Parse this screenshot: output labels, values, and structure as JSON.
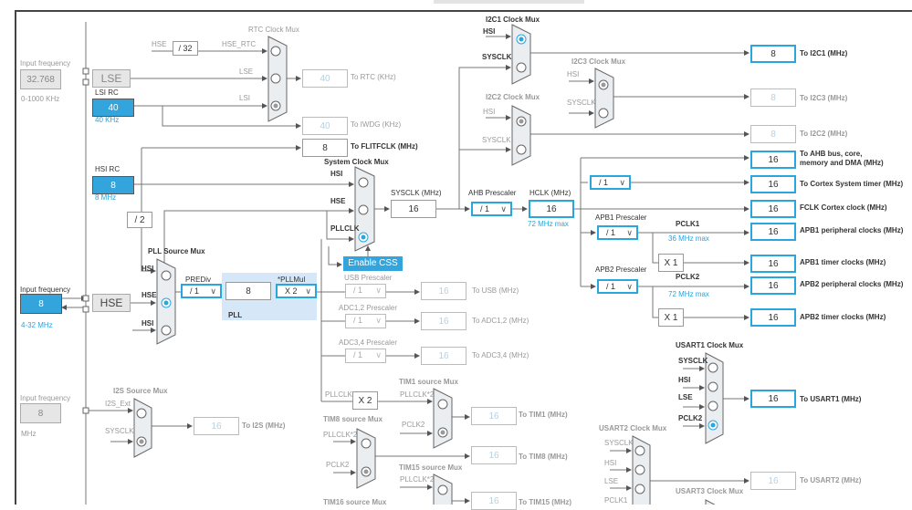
{
  "lse_input": {
    "label": "Input frequency",
    "value": "32.768",
    "range": "0-1000 KHz"
  },
  "lse": {
    "label": "LSE"
  },
  "lsi": {
    "title": "LSI RC",
    "value": "40",
    "freq": "40 KHz"
  },
  "rtc_mux": {
    "title": "RTC Clock Mux",
    "hse": "HSE",
    "div": "/ 32",
    "hse_rtc": "HSE_RTC",
    "lse": "LSE",
    "lsi": "LSI",
    "selected": "LSI"
  },
  "rtc_out": {
    "value": "40",
    "label": "To RTC (KHz)"
  },
  "iwdg_out": {
    "value": "40",
    "label": "To IWDG (KHz)"
  },
  "flitf_out": {
    "value": "8",
    "label": "To FLITFCLK (MHz)"
  },
  "hsi": {
    "title": "HSI RC",
    "value": "8",
    "freq": "8 MHz",
    "div2": "/ 2"
  },
  "sys_mux": {
    "title": "System Clock Mux",
    "hsi": "HSI",
    "hse": "HSE",
    "pllclk": "PLLCLK",
    "selected": "PLLCLK"
  },
  "sysclk": {
    "label": "SYSCLK (MHz)",
    "value": "16"
  },
  "enable_css": "Enable CSS",
  "pll_mux": {
    "title": "PLL Source Mux",
    "hsi1": "HSI",
    "hse": "HSE",
    "hsi2": "HSI",
    "selected": "HSE"
  },
  "hse_input": {
    "label": "Input frequency",
    "value": "8",
    "range": "4-32 MHz",
    "box": "HSE"
  },
  "pll": {
    "prediv_label": "PREDiv",
    "prediv": "/ 1",
    "value": "8",
    "mul_label": "*PLLMul",
    "mul": "X 2",
    "title": "PLL"
  },
  "usb": {
    "label": "USB Prescaler",
    "presc": "/ 1",
    "value": "16",
    "out": "To USB (MHz)"
  },
  "adc12": {
    "label": "ADC1,2 Prescaler",
    "presc": "/ 1",
    "value": "16",
    "out": "To ADC1,2 (MHz)"
  },
  "adc34": {
    "label": "ADC3,4 Prescaler",
    "presc": "/ 1",
    "value": "16",
    "out": "To ADC3,4 (MHz)"
  },
  "tim": {
    "pllclk": "PLLCLK",
    "x2": "X 2",
    "tim1": {
      "title": "TIM1 source Mux",
      "in1": "PLLCLK*2",
      "in2": "PCLK2",
      "value": "16",
      "out": "To TIM1 (MHz)"
    },
    "tim8": {
      "title": "TIM8 source Mux",
      "in1": "PLLCLK*2",
      "in2": "PCLK2",
      "value": "16",
      "out": "To TIM8 (MHz)"
    },
    "tim15": {
      "title": "TIM15 source Mux",
      "in1": "PLLCLK*2",
      "value": "16",
      "out": "To TIM15 (MHz)"
    },
    "tim16": {
      "title": "TIM16 source Mux"
    }
  },
  "i2s_input": {
    "label": "Input frequency",
    "value": "8",
    "unit": "MHz"
  },
  "i2s": {
    "title": "I2S Source Mux",
    "in1": "I2S_Ext",
    "in2": "SYSCLK",
    "value": "16",
    "out": "To I2S (MHz)"
  },
  "i2c1": {
    "title": "I2C1 Clock Mux",
    "hsi": "HSI",
    "sysclk": "SYSCLK",
    "value": "8",
    "out": "To I2C1 (MHz)",
    "selected": "HSI"
  },
  "i2c3": {
    "title": "I2C3 Clock Mux",
    "hsi": "HSI",
    "sysclk": "SYSCLK",
    "value": "8",
    "out": "To I2C3 (MHz)"
  },
  "i2c2": {
    "title": "I2C2 Clock Mux",
    "hsi": "HSI",
    "sysclk": "SYSCLK",
    "value": "8",
    "out": "To I2C2 (MHz)"
  },
  "ahb": {
    "label": "AHB Prescaler",
    "presc": "/ 1"
  },
  "hclk": {
    "label": "HCLK (MHz)",
    "value": "16",
    "max": "72 MHz max"
  },
  "outputs": {
    "ahb": {
      "value": "16",
      "l1": "To AHB bus, core,",
      "l2": "memory and DMA (MHz)"
    },
    "cortex_presc": "/ 1",
    "cortex": {
      "value": "16",
      "label": "To Cortex System timer (MHz)"
    },
    "fclk": {
      "value": "16",
      "label": "FCLK Cortex clock (MHz)"
    },
    "apb1p": {
      "value": "16",
      "label": "APB1 peripheral clocks (MHz)"
    },
    "apb1t": {
      "value": "16",
      "label": "APB1 timer clocks (MHz)"
    },
    "apb2p": {
      "value": "16",
      "label": "APB2 peripheral clocks (MHz)"
    },
    "apb2t": {
      "value": "16",
      "label": "APB2 timer clocks (MHz)"
    }
  },
  "apb1": {
    "label": "APB1 Prescaler",
    "presc": "/ 1",
    "pclk": "PCLK1",
    "max": "36 MHz max",
    "x1": "X 1"
  },
  "apb2": {
    "label": "APB2 Prescaler",
    "presc": "/ 1",
    "pclk": "PCLK2",
    "max": "72 MHz max",
    "x1": "X 1"
  },
  "usart1": {
    "title": "USART1 Clock Mux",
    "in1": "SYSCLK",
    "in2": "HSI",
    "in3": "LSE",
    "in4": "PCLK2",
    "value": "16",
    "out": "To USART1 (MHz)",
    "selected": "PCLK2"
  },
  "usart2": {
    "title": "USART2 Clock Mux",
    "in1": "SYSCLK",
    "in2": "HSI",
    "in3": "LSE",
    "in4": "PCLK1",
    "value": "16",
    "out": "To USART2 (MHz)"
  },
  "usart3": {
    "title": "USART3 Clock Mux"
  },
  "colors": {
    "accent": "#2aa6df",
    "fill": "#33a5dc",
    "pll_bg": "#d6e8f7"
  }
}
